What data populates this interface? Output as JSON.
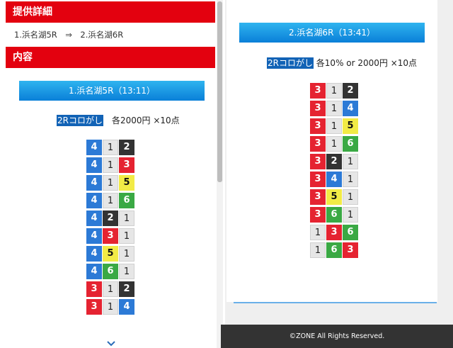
{
  "left": {
    "section1_title": "提供詳細",
    "route": "1.浜名湖5R　⇒　2.浜名湖6R",
    "section2_title": "内容",
    "race_bar": "1.浜名湖5R（13:11）",
    "bet_tag": "2Rコロがし",
    "bet_text": "　各2000円 ×10点",
    "combos": [
      [
        4,
        1,
        2
      ],
      [
        4,
        1,
        3
      ],
      [
        4,
        1,
        5
      ],
      [
        4,
        1,
        6
      ],
      [
        4,
        2,
        1
      ],
      [
        4,
        3,
        1
      ],
      [
        4,
        5,
        1
      ],
      [
        4,
        6,
        1
      ],
      [
        3,
        1,
        2
      ],
      [
        3,
        1,
        4
      ]
    ],
    "more_icon": "chevron-down-icon"
  },
  "right": {
    "race_bar": "2.浜名湖6R（13:41）",
    "bet_tag": "2Rコロがし",
    "bet_text": " 各10% or 2000円 ×10点",
    "combos": [
      [
        3,
        1,
        2
      ],
      [
        3,
        1,
        4
      ],
      [
        3,
        1,
        5
      ],
      [
        3,
        1,
        6
      ],
      [
        3,
        2,
        1
      ],
      [
        3,
        4,
        1
      ],
      [
        3,
        5,
        1
      ],
      [
        3,
        6,
        1
      ],
      [
        1,
        3,
        6
      ],
      [
        1,
        6,
        3
      ]
    ]
  },
  "footer": "©ZONE All Rights Reserved.",
  "colors": {
    "header_red": "#e3010f",
    "bar_blue": "#0a7fd8",
    "highlight_blue": "#1263b6",
    "boat1": "#e6e6e6",
    "boat2": "#333333",
    "boat3": "#e52331",
    "boat4": "#2c7ad6",
    "boat5": "#f2eb46",
    "boat6": "#3aa944"
  }
}
